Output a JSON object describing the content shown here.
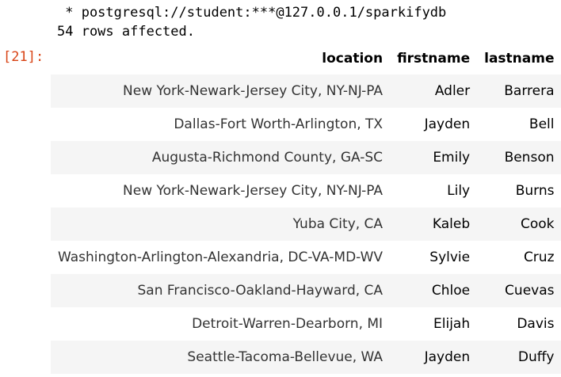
{
  "output": {
    "connection_line": " * postgresql://student:***@127.0.0.1/sparkifydb",
    "rows_affected": "54 rows affected."
  },
  "cell": {
    "prompt": "[21]:"
  },
  "table": {
    "headers": [
      "location",
      "firstname",
      "lastname"
    ],
    "rows": [
      [
        "New York-Newark-Jersey City, NY-NJ-PA",
        "Adler",
        "Barrera"
      ],
      [
        "Dallas-Fort Worth-Arlington, TX",
        "Jayden",
        "Bell"
      ],
      [
        "Augusta-Richmond County, GA-SC",
        "Emily",
        "Benson"
      ],
      [
        "New York-Newark-Jersey City, NY-NJ-PA",
        "Lily",
        "Burns"
      ],
      [
        "Yuba City, CA",
        "Kaleb",
        "Cook"
      ],
      [
        "Washington-Arlington-Alexandria, DC-VA-MD-WV",
        "Sylvie",
        "Cruz"
      ],
      [
        "San Francisco-Oakland-Hayward, CA",
        "Chloe",
        "Cuevas"
      ],
      [
        "Detroit-Warren-Dearborn, MI",
        "Elijah",
        "Davis"
      ],
      [
        "Seattle-Tacoma-Bellevue, WA",
        "Jayden",
        "Duffy"
      ]
    ]
  }
}
